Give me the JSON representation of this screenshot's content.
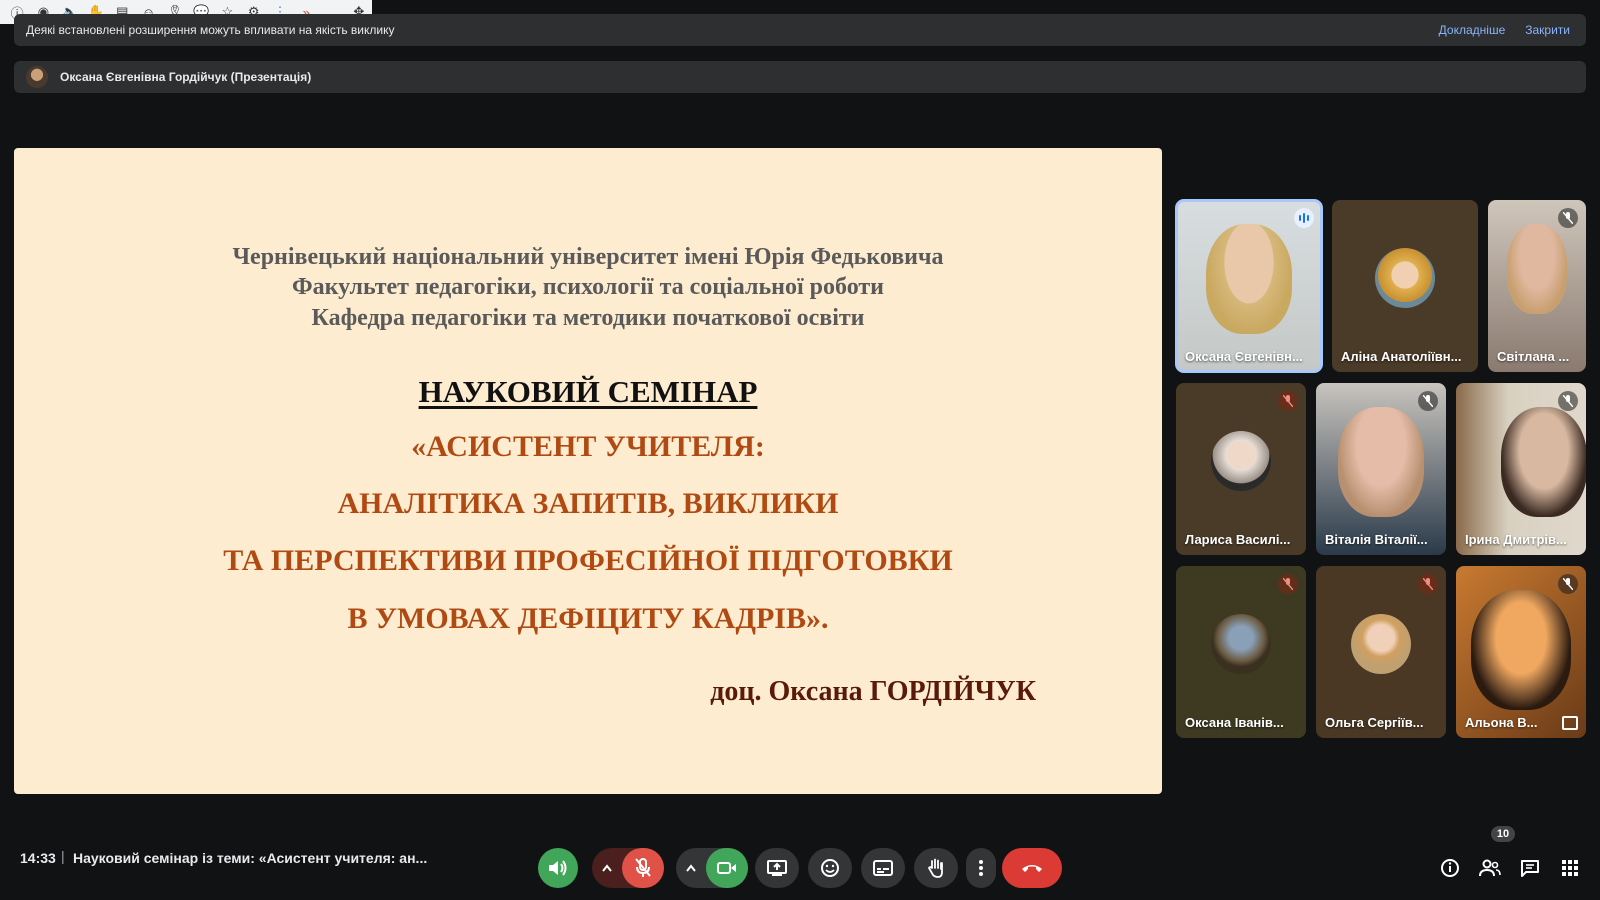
{
  "extensions_bar": {
    "icons": [
      "info-icon",
      "eye-icon",
      "speaker-icon",
      "hand-icon",
      "notepad-icon",
      "emoji-icon",
      "ribbon-icon",
      "chat-bubble-icon",
      "star-icon",
      "gear-icon",
      "more-vertical-icon",
      "chevrons-right-icon",
      "minimize-icon",
      "move-icon"
    ]
  },
  "banner": {
    "message": "Деякі встановлені розширення можуть впливати на якість виклику",
    "learn_more": "Докладніше",
    "close": "Закрити"
  },
  "presenter": {
    "label": "Оксана Євгенівна Гордійчук (Презентація)"
  },
  "slide": {
    "institution_lines": [
      "Чернівецький національний університет імені Юрія Федьковича",
      "Факультет педагогіки, психології та соціальної роботи",
      "Кафедра педагогіки та методики початкової освіти"
    ],
    "seminar_heading": "НАУКОВИЙ СЕМІНАР",
    "topic_lines": [
      "«АСИСТЕНТ УЧИТЕЛЯ:",
      "АНАЛІТИКА ЗАПИТІВ, ВИКЛИКИ",
      "ТА ПЕРСПЕКТИВИ ПРОФЕСІЙНОЇ ПІДГОТОВКИ",
      "В УМОВАХ ДЕФІЦИТУ КАДРІВ»."
    ],
    "author": "доц. Оксана ГОРДІЙЧУК"
  },
  "participants": [
    {
      "name": "Оксана Євгенівн...",
      "state": "speaking"
    },
    {
      "name": "Аліна Анатоліївн...",
      "state": "none"
    },
    {
      "name": "Світлана ...",
      "state": "muted"
    },
    {
      "name": "Лариса Василі...",
      "state": "muted-orange"
    },
    {
      "name": "Віталія Віталії...",
      "state": "muted"
    },
    {
      "name": "Ірина Дмитрів...",
      "state": "muted"
    },
    {
      "name": "Оксана Іванів...",
      "state": "muted-orange"
    },
    {
      "name": "Ольга Сергіїв...",
      "state": "muted-orange"
    },
    {
      "name": "Альона В...",
      "state": "muted"
    }
  ],
  "bottom_bar": {
    "time": "14:33",
    "separator": "|",
    "meeting_title": "Науковий семінар із теми: «Асистент учителя: ан...",
    "participant_count": "10",
    "colors": {
      "green": "#41a65a",
      "red": "#e05247",
      "hangup": "#dc3b35"
    }
  }
}
